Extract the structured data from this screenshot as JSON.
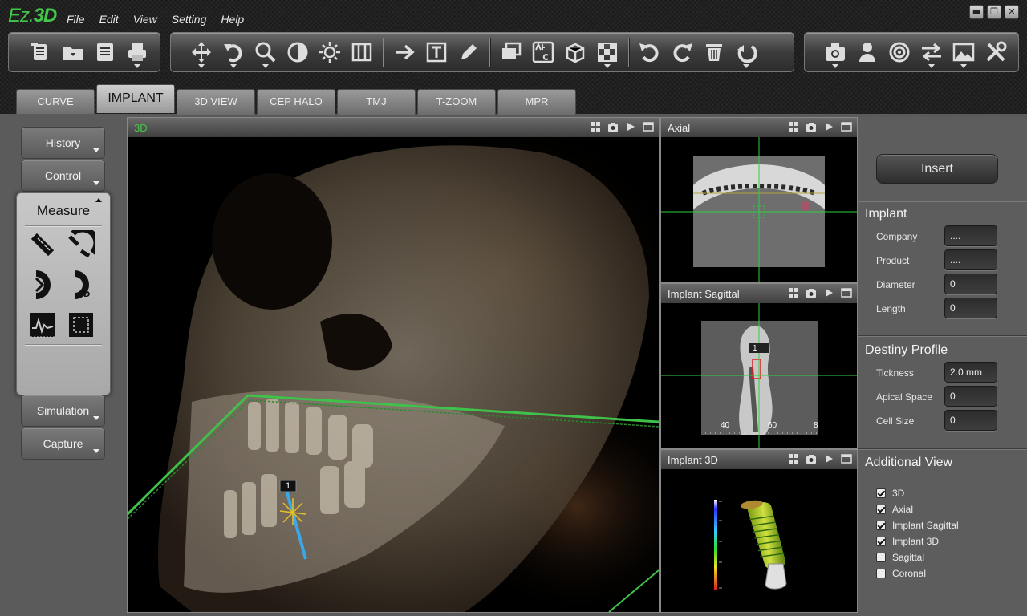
{
  "app": {
    "logo_prefix": "Ez.",
    "logo_suffix": "3D"
  },
  "menu": [
    "File",
    "Edit",
    "View",
    "Setting",
    "Help"
  ],
  "window_controls": {
    "minimize": "▬",
    "restore": "❐",
    "close": "✕"
  },
  "tabs": [
    "CURVE",
    "IMPLANT",
    "3D VIEW",
    "CEP HALO",
    "TMJ",
    "T-ZOOM",
    "MPR"
  ],
  "active_tab": "IMPLANT",
  "left_panel": {
    "history": "History",
    "control": "Control",
    "measure": "Measure",
    "simulation": "Simulation",
    "capture": "Capture"
  },
  "views": {
    "main": {
      "title": "3D",
      "marker": "1"
    },
    "axial": {
      "title": "Axial"
    },
    "sagittal": {
      "title": "Implant Sagittal",
      "marker": "1",
      "ruler": [
        "40",
        "60",
        "8"
      ]
    },
    "implant3d": {
      "title": "Implant 3D"
    }
  },
  "right_panel": {
    "insert": "Insert",
    "implant": {
      "title": "Implant",
      "fields": [
        {
          "label": "Company",
          "value": "...."
        },
        {
          "label": "Product",
          "value": "...."
        },
        {
          "label": "Diameter",
          "value": "0"
        },
        {
          "label": "Length",
          "value": "0"
        }
      ]
    },
    "profile": {
      "title": "Destiny Profile",
      "fields": [
        {
          "label": "Tickness",
          "value": "2.0 mm"
        },
        {
          "label": "Apical Space",
          "value": "0"
        },
        {
          "label": "Cell Size",
          "value": "0"
        }
      ]
    },
    "additional": {
      "title": "Additional View",
      "items": [
        {
          "label": "3D",
          "checked": true
        },
        {
          "label": "Axial",
          "checked": true
        },
        {
          "label": "Implant Sagittal",
          "checked": true
        },
        {
          "label": "Implant 3D",
          "checked": true
        },
        {
          "label": "Sagittal",
          "checked": false
        },
        {
          "label": "Coronal",
          "checked": false
        }
      ]
    }
  },
  "colors": {
    "accent_green": "#43c64a",
    "toolbar_bg": "#1c1c1c",
    "panel_bg": "#5d5d5d"
  }
}
